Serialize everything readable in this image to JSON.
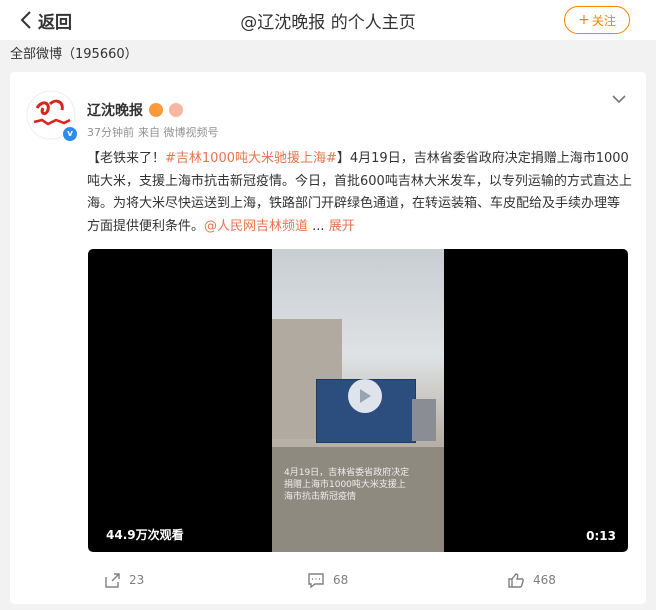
{
  "header": {
    "back_label": "返回",
    "title": "@辽沈晚报 的个人主页",
    "follow_label": "关注",
    "accent": "#ff8200"
  },
  "profile": {
    "all_weibo": "全部微博（195660）"
  },
  "post": {
    "author": "辽沈晚报",
    "time": "37分钟前",
    "source": "来自 微博视频号",
    "text": {
      "lead": "【老铁来了！",
      "hashtag": "#吉林1000吨大米驰援上海#",
      "body": "】4月19日，吉林省委省政府决定捐赠上海市1000吨大米，支援上海市抗击新冠疫情。今日，首批600吨吉林大米发车，以专列运输的方式直达上海。为将大米尽快运送到上海，铁路部门开辟绿色通道，在转运装箱、车皮配给及手续办理等方面提供便利条件。",
      "mention": "@人民网吉林频道",
      "ellipsis": "...",
      "expand": "展开"
    },
    "video": {
      "views": "44.9万次观看",
      "duration": "0:13",
      "caption": "4月19日，吉林省委省政府决定捐赠上海市1000吨大米支援上海市抗击新冠疫情"
    },
    "actions": {
      "repost": "23",
      "comment": "68",
      "like": "468"
    },
    "link_color": "#eb7350"
  }
}
